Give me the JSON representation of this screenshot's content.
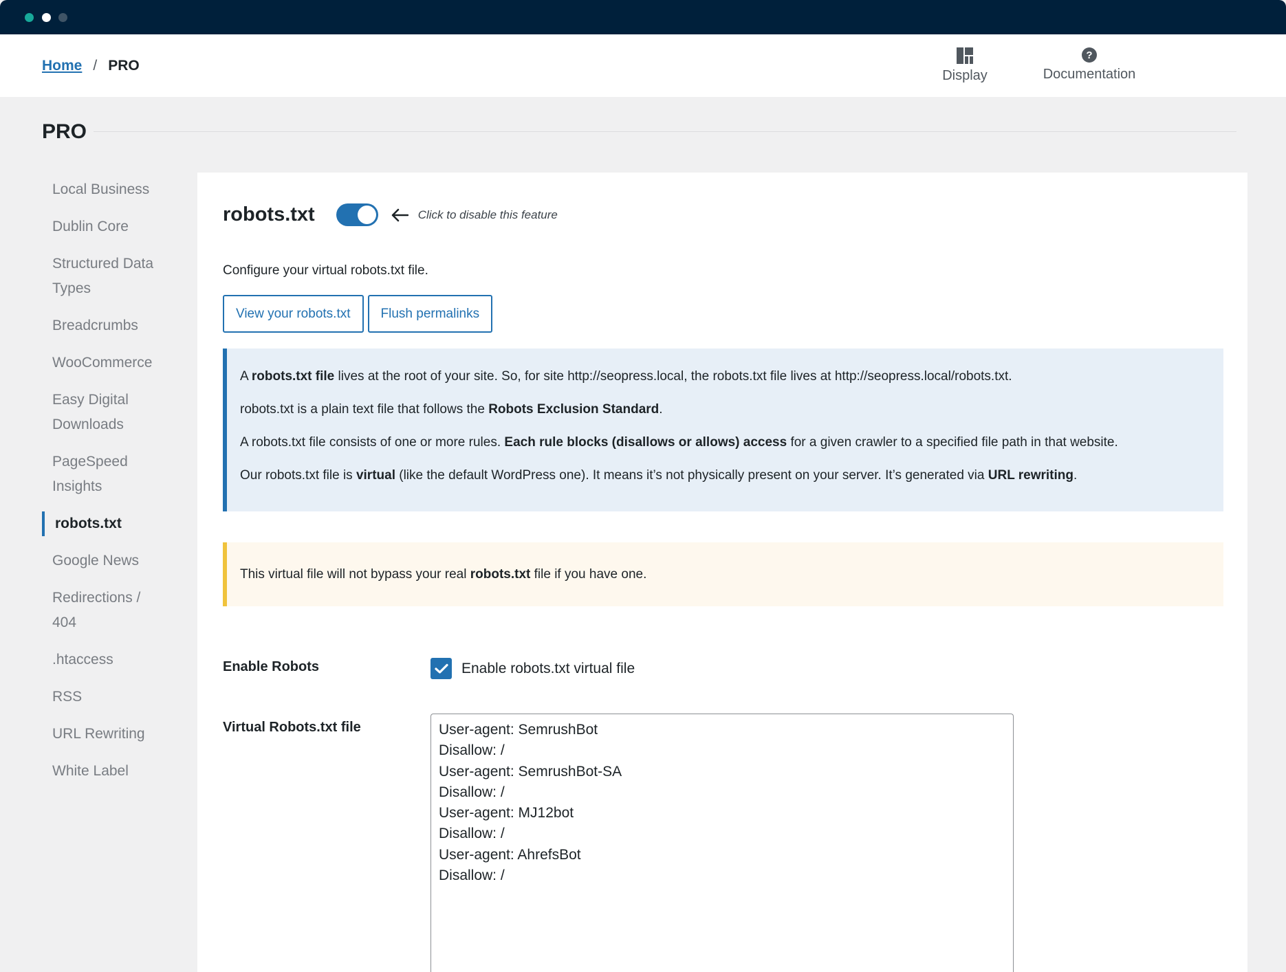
{
  "breadcrumb": {
    "home": "Home",
    "separator": "/",
    "current": "PRO"
  },
  "top_actions": {
    "display": "Display",
    "documentation": "Documentation"
  },
  "page": {
    "title": "PRO"
  },
  "sidebar": {
    "items": [
      {
        "label": "Local Business",
        "active": false
      },
      {
        "label": "Dublin Core",
        "active": false
      },
      {
        "label": "Structured Data Types",
        "active": false
      },
      {
        "label": "Breadcrumbs",
        "active": false
      },
      {
        "label": "WooCommerce",
        "active": false
      },
      {
        "label": "Easy Digital Downloads",
        "active": false
      },
      {
        "label": "PageSpeed Insights",
        "active": false
      },
      {
        "label": "robots.txt",
        "active": true
      },
      {
        "label": "Google News",
        "active": false
      },
      {
        "label": "Redirections / 404",
        "active": false
      },
      {
        "label": ".htaccess",
        "active": false
      },
      {
        "label": "RSS",
        "active": false
      },
      {
        "label": "URL Rewriting",
        "active": false
      },
      {
        "label": "White Label",
        "active": false
      }
    ]
  },
  "feature": {
    "title": "robots.txt",
    "toggle_on": true,
    "hint": "Click to disable this feature",
    "description": "Configure your virtual robots.txt file.",
    "view_button": "View your robots.txt",
    "flush_button": "Flush permalinks"
  },
  "info_notice": {
    "p1": {
      "t1": "A ",
      "b1": "robots.txt file",
      "t2": " lives at the root of your site. So, for site http://seopress.local, the robots.txt file lives at http://seopress.local/robots.txt."
    },
    "p2": {
      "t1": "robots.txt is a plain text file that follows the ",
      "b1": "Robots Exclusion Standard",
      "t2": "."
    },
    "p3": {
      "t1": "A robots.txt file consists of one or more rules. ",
      "b1": "Each rule blocks (disallows or allows) access",
      "t2": " for a given crawler to a specified file path in that website."
    },
    "p4": {
      "t1": "Our robots.txt file is ",
      "b1": "virtual",
      "t2": " (like the default WordPress one). It means it’s not physically present on your server. It’s generated via ",
      "b2": "URL rewriting",
      "t3": "."
    }
  },
  "warn_notice": {
    "t1": "This virtual file will not bypass your real ",
    "b1": "robots.txt",
    "t2": " file if you have one."
  },
  "fields": {
    "enable_label": "Enable Robots",
    "enable_checkbox_label": "Enable robots.txt virtual file",
    "enable_checked": true,
    "virtual_label": "Virtual Robots.txt file",
    "virtual_value": "User-agent: SemrushBot\nDisallow: /\nUser-agent: SemrushBot-SA\nDisallow: /\nUser-agent: MJ12bot\nDisallow: /\nUser-agent: AhrefsBot\nDisallow: /"
  },
  "colors": {
    "accent": "#2271b1",
    "titlebar": "#00203b",
    "info_bg": "#e7eff7",
    "warn_bg": "#fef8ee",
    "warn_border": "#f0c33c"
  }
}
